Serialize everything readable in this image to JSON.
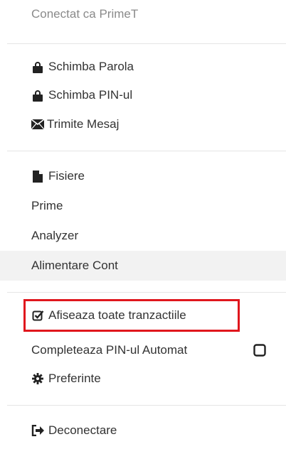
{
  "status": {
    "connected_text": "Conectat ca PrimeT"
  },
  "account": {
    "items": [
      {
        "label": "Schimba Parola",
        "icon": "lock-icon"
      },
      {
        "label": "Schimba PIN-ul",
        "icon": "lock-icon"
      },
      {
        "label": "Trimite Mesaj",
        "icon": "envelope-icon"
      }
    ]
  },
  "files": {
    "items": [
      {
        "label": "Fisiere",
        "icon": "file-icon"
      },
      {
        "label": "Prime",
        "icon": ""
      },
      {
        "label": "Analyzer",
        "icon": ""
      },
      {
        "label": "Alimentare Cont",
        "icon": "",
        "active": true
      }
    ]
  },
  "options": {
    "items": [
      {
        "label": "Afiseaza toate tranzactiile",
        "icon": "checked-square-icon",
        "highlighted": true
      },
      {
        "label": "Completeaza PIN-ul Automat",
        "icon": "",
        "toggle": "unchecked-square-icon"
      },
      {
        "label": "Preferinte",
        "icon": "cog-icon"
      }
    ]
  },
  "session": {
    "items": [
      {
        "label": "Deconectare",
        "icon": "sign-out-icon"
      }
    ]
  },
  "colors": {
    "highlight_border": "#e0161d",
    "active_bg": "#f2f2f2",
    "muted_text": "#8a8a8a"
  }
}
